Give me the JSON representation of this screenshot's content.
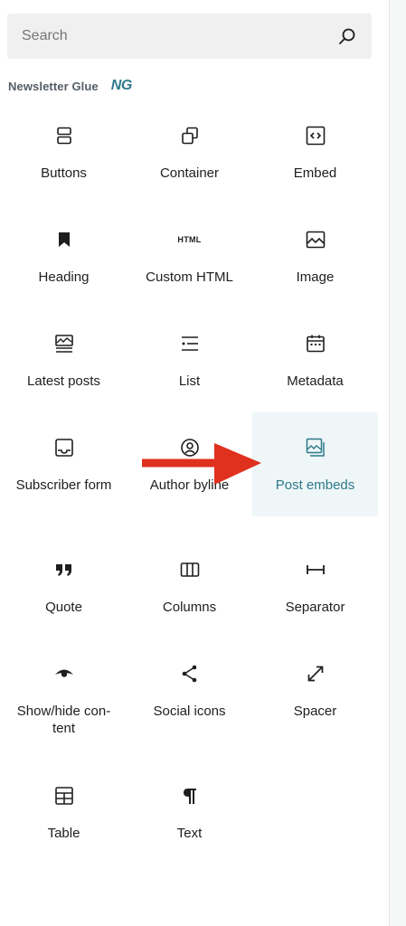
{
  "search": {
    "placeholder": "Search"
  },
  "category": {
    "label": "Newsletter Glue",
    "logo_text": "NG"
  },
  "blocks": [
    {
      "label": "Buttons",
      "icon": "buttons-icon"
    },
    {
      "label": "Container",
      "icon": "container-icon"
    },
    {
      "label": "Embed",
      "icon": "embed-icon"
    },
    {
      "label": "Heading",
      "icon": "heading-bookmark-icon"
    },
    {
      "label": "Custom HTML",
      "icon": "html-icon",
      "icon_text": "HTML"
    },
    {
      "label": "Image",
      "icon": "image-icon"
    },
    {
      "label": "Latest posts",
      "icon": "latest-posts-icon"
    },
    {
      "label": "List",
      "icon": "list-icon"
    },
    {
      "label": "Metadata",
      "icon": "calendar-icon"
    },
    {
      "label": "Subscriber form",
      "icon": "subscriber-form-icon"
    },
    {
      "label": "Author byline",
      "icon": "author-icon"
    },
    {
      "label": "Post embeds",
      "icon": "post-embeds-icon",
      "active": true
    },
    {
      "label": "Quote",
      "icon": "quote-icon"
    },
    {
      "label": "Columns",
      "icon": "columns-icon"
    },
    {
      "label": "Separator",
      "icon": "separator-icon"
    },
    {
      "label": "Show/hide con-tent",
      "icon": "eye-icon"
    },
    {
      "label": "Social icons",
      "icon": "share-icon"
    },
    {
      "label": "Spacer",
      "icon": "resize-icon"
    },
    {
      "label": "Table",
      "icon": "table-icon"
    },
    {
      "label": "Text",
      "icon": "paragraph-icon"
    }
  ],
  "colors": {
    "accent": "#2f7a8c",
    "active_bg": "#eef6f7",
    "arrow": "#e0301e"
  }
}
